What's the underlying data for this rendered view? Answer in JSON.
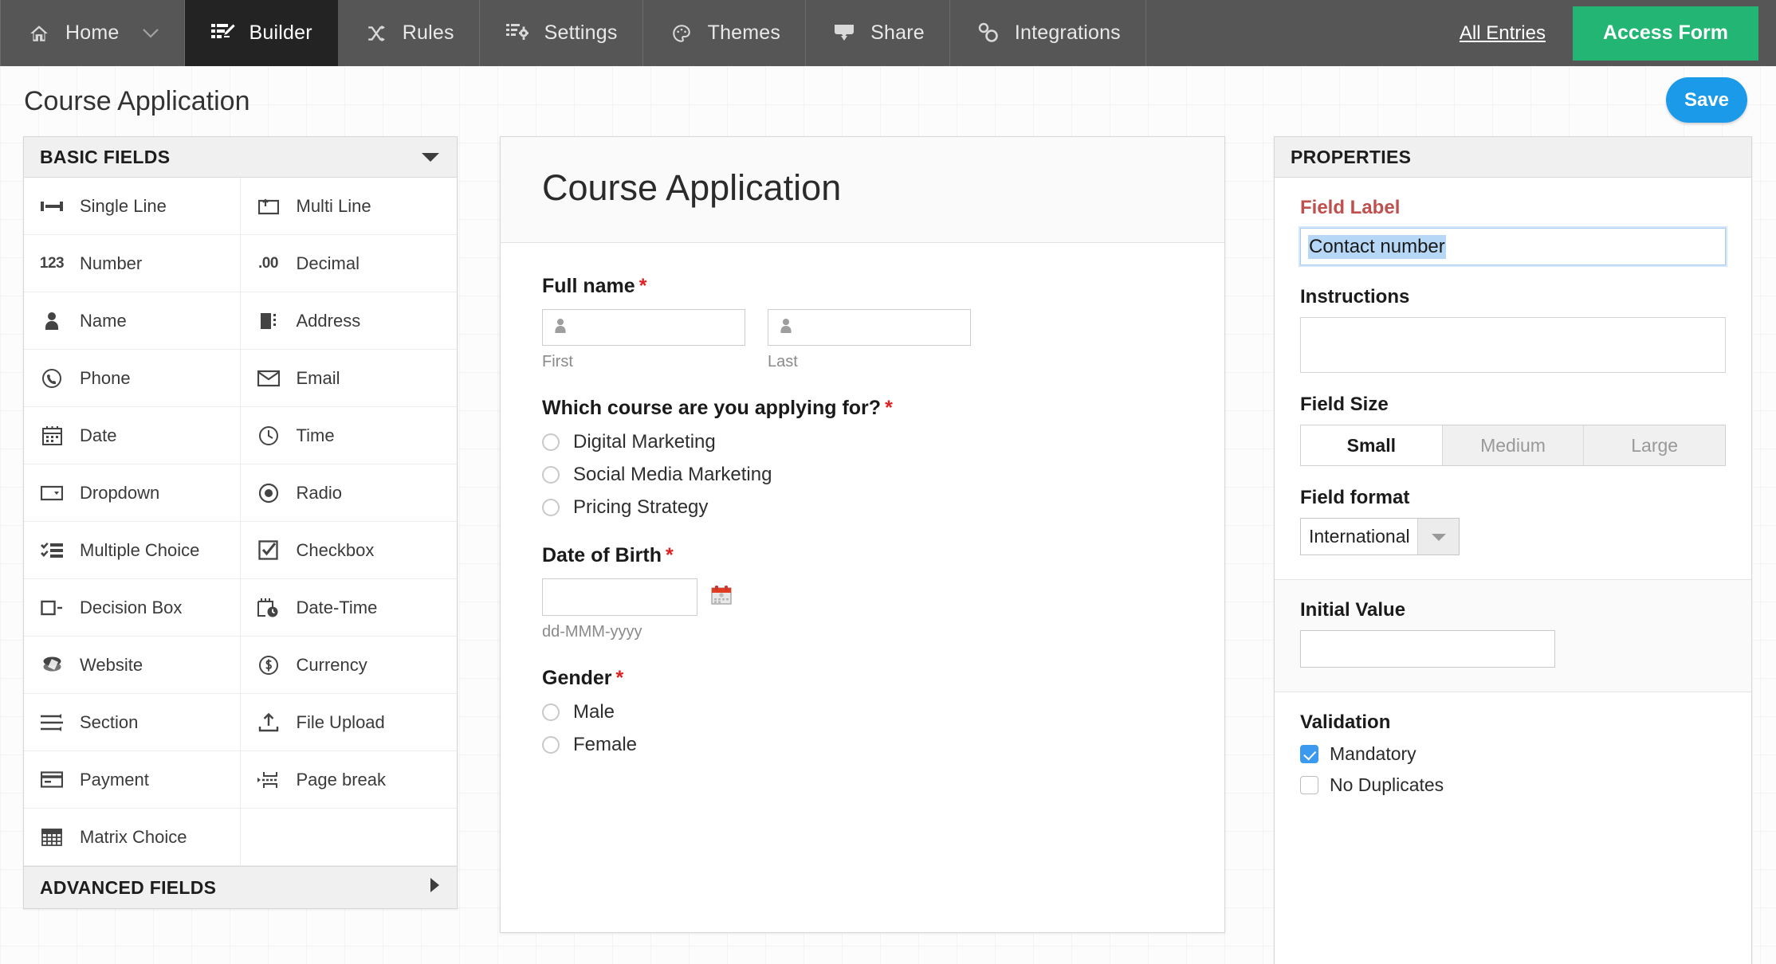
{
  "topnav": {
    "items": [
      {
        "label": "Home",
        "icon": "home-icon",
        "active": false,
        "caret": true
      },
      {
        "label": "Builder",
        "icon": "builder-icon",
        "active": true,
        "caret": false
      },
      {
        "label": "Rules",
        "icon": "rules-icon",
        "active": false,
        "caret": false
      },
      {
        "label": "Settings",
        "icon": "settings-icon",
        "active": false,
        "caret": false
      },
      {
        "label": "Themes",
        "icon": "themes-icon",
        "active": false,
        "caret": false
      },
      {
        "label": "Share",
        "icon": "share-icon",
        "active": false,
        "caret": false
      },
      {
        "label": "Integrations",
        "icon": "integrations-icon",
        "active": false,
        "caret": false
      }
    ],
    "all_entries": "All Entries",
    "access_form": "Access Form",
    "accent_green": "#22b573",
    "bar_bg": "#565656",
    "active_bg": "#232323"
  },
  "page": {
    "title": "Course Application",
    "save_label": "Save",
    "save_color": "#1a9ae8"
  },
  "left_panel": {
    "header": "BASIC FIELDS",
    "footer": "ADVANCED FIELDS",
    "fields": [
      {
        "label": "Single Line",
        "icon": "single-line-icon"
      },
      {
        "label": "Multi Line",
        "icon": "multi-line-icon"
      },
      {
        "label": "Number",
        "icon": "number-123-icon"
      },
      {
        "label": "Decimal",
        "icon": "decimal-00-icon"
      },
      {
        "label": "Name",
        "icon": "person-icon"
      },
      {
        "label": "Address",
        "icon": "address-icon"
      },
      {
        "label": "Phone",
        "icon": "phone-icon"
      },
      {
        "label": "Email",
        "icon": "envelope-icon"
      },
      {
        "label": "Date",
        "icon": "calendar-icon"
      },
      {
        "label": "Time",
        "icon": "clock-icon"
      },
      {
        "label": "Dropdown",
        "icon": "dropdown-icon"
      },
      {
        "label": "Radio",
        "icon": "radio-icon"
      },
      {
        "label": "Multiple Choice",
        "icon": "multiple-choice-icon"
      },
      {
        "label": "Checkbox",
        "icon": "checkbox-icon"
      },
      {
        "label": "Decision Box",
        "icon": "decision-box-icon"
      },
      {
        "label": "Date-Time",
        "icon": "date-time-icon"
      },
      {
        "label": "Website",
        "icon": "globe-icon"
      },
      {
        "label": "Currency",
        "icon": "currency-dollar-icon"
      },
      {
        "label": "Section",
        "icon": "section-icon"
      },
      {
        "label": "File Upload",
        "icon": "upload-icon"
      },
      {
        "label": "Payment",
        "icon": "credit-card-icon"
      },
      {
        "label": "Page break",
        "icon": "page-break-icon"
      },
      {
        "label": "Matrix Choice",
        "icon": "matrix-grid-icon"
      }
    ]
  },
  "form": {
    "banner_title": "Course Application",
    "blocks": [
      {
        "type": "name",
        "label": "Full name",
        "required": true,
        "sub_labels": [
          "First",
          "Last"
        ]
      },
      {
        "type": "radio",
        "label": "Which course are you applying for?",
        "required": true,
        "options": [
          "Digital Marketing",
          "Social Media Marketing",
          "Pricing Strategy"
        ]
      },
      {
        "type": "date",
        "label": "Date of Birth",
        "required": true,
        "hint": "dd-MMM-yyyy"
      },
      {
        "type": "radio",
        "label": "Gender",
        "required": true,
        "options": [
          "Male",
          "Female"
        ]
      }
    ]
  },
  "properties": {
    "header": "PROPERTIES",
    "field_label_title": "Field Label",
    "field_label_value": "Contact number",
    "instructions_title": "Instructions",
    "instructions_value": "",
    "field_size_title": "Field Size",
    "field_size_options": [
      "Small",
      "Medium",
      "Large"
    ],
    "field_size_selected": "Small",
    "field_format_title": "Field format",
    "field_format_value": "International",
    "initial_value_title": "Initial Value",
    "initial_value": "",
    "validation_title": "Validation",
    "validation_items": [
      {
        "label": "Mandatory",
        "checked": true
      },
      {
        "label": "No Duplicates",
        "checked": false
      }
    ],
    "selection_highlight": "#b6d7f5",
    "label_accent": "#c0504d"
  }
}
